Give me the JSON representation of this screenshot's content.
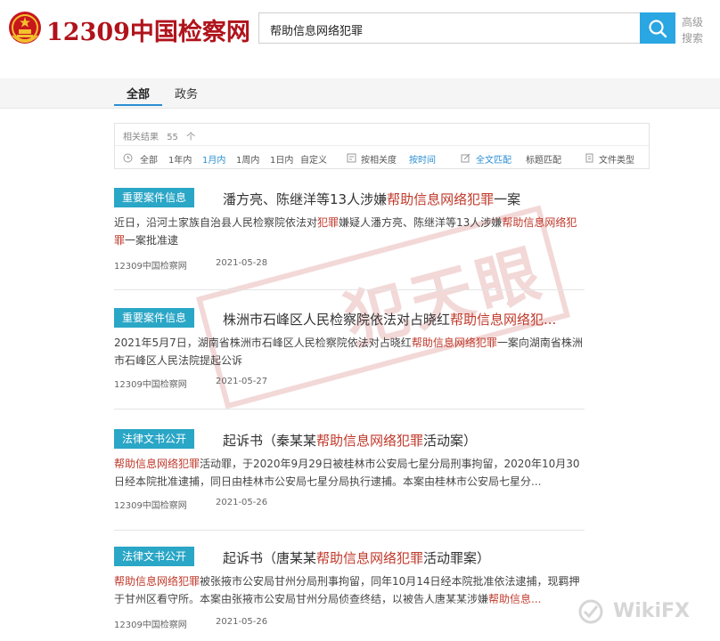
{
  "header": {
    "logo_text": "12309中国检察网",
    "search_value": "帮助信息网络犯罪",
    "advanced_search_line1": "高级",
    "advanced_search_line2": "搜索"
  },
  "tabs": [
    {
      "label": "全部",
      "active": true
    },
    {
      "label": "政务",
      "active": false
    }
  ],
  "filter": {
    "result_count_label": "相关结果",
    "result_count_value": "55",
    "result_count_unit": "个",
    "time_filters": [
      "全部",
      "1年内",
      "1月内",
      "1周内",
      "1日内",
      "自定义"
    ],
    "active_time_filter": "1月内",
    "sort_options": [
      "按相关度",
      "按时间"
    ],
    "active_sort": "按时间",
    "match_options": [
      "全文匹配",
      "标题匹配"
    ],
    "active_match": "全文匹配",
    "file_type_label": "文件类型"
  },
  "results": [
    {
      "badge": "重要案件信息",
      "title_pre": "潘方亮、陈继洋等13人涉嫌",
      "title_hl": "帮助信息网络犯罪",
      "title_post": "一案",
      "abstract_parts": [
        {
          "t": "近日，沿河土家族自治县人民检察院依法对",
          "hl": false
        },
        {
          "t": "犯罪",
          "hl": true
        },
        {
          "t": "嫌疑人潘方亮、陈继洋等13人涉嫌",
          "hl": false
        },
        {
          "t": "帮助信息网络犯罪",
          "hl": true
        },
        {
          "t": "一案批准逮",
          "hl": false
        }
      ],
      "source": "12309中国检察网",
      "date": "2021-05-28"
    },
    {
      "badge": "重要案件信息",
      "title_pre": "株洲市石峰区人民检察院依法对占晓红",
      "title_hl": "帮助信息网络犯...",
      "title_post": "",
      "abstract_parts": [
        {
          "t": "2021年5月7日，湖南省株洲市石峰区人民检察院依法对占晓红",
          "hl": false
        },
        {
          "t": "帮助信息网络犯罪",
          "hl": true
        },
        {
          "t": "一案向湖南省株洲市石峰区人民法院提起公诉",
          "hl": false
        }
      ],
      "source": "12309中国检察网",
      "date": "2021-05-27"
    },
    {
      "badge": "法律文书公开",
      "title_pre": "起诉书（秦某某",
      "title_hl": "帮助信息网络犯罪",
      "title_post": "活动案）",
      "abstract_parts": [
        {
          "t": "帮助信息网络犯罪",
          "hl": true
        },
        {
          "t": "活动罪，于2020年9月29日被桂林市公安局七星分局刑事拘留，2020年10月30日经本院批准逮捕，同日由桂林市公安局七星分局执行逮捕。本案由桂林市公安局七星分...",
          "hl": false
        }
      ],
      "source": "12309中国检察网",
      "date": "2021-05-26"
    },
    {
      "badge": "法律文书公开",
      "title_pre": "起诉书（唐某某",
      "title_hl": "帮助信息网络犯罪",
      "title_post": "活动罪案）",
      "abstract_parts": [
        {
          "t": "帮助信息网络犯罪",
          "hl": true
        },
        {
          "t": "被张掖市公安局甘州分局刑事拘留，同年10月14日经本院批准依法逮捕，现羁押于甘州区看守所。本案由张掖市公安局甘州分局侦查终结，以被告人唐某某涉嫌",
          "hl": false
        },
        {
          "t": "帮助信息...",
          "hl": true
        }
      ],
      "source": "12309中国检察网",
      "date": "2021-05-26"
    }
  ],
  "stamp_text": "犯天眼",
  "watermark_text": "WikiFX",
  "colors": {
    "brand_red": "#b0131b",
    "accent_blue": "#2aa6e2",
    "badge_teal": "#2aa6c6",
    "highlight_red": "#c0392b"
  }
}
